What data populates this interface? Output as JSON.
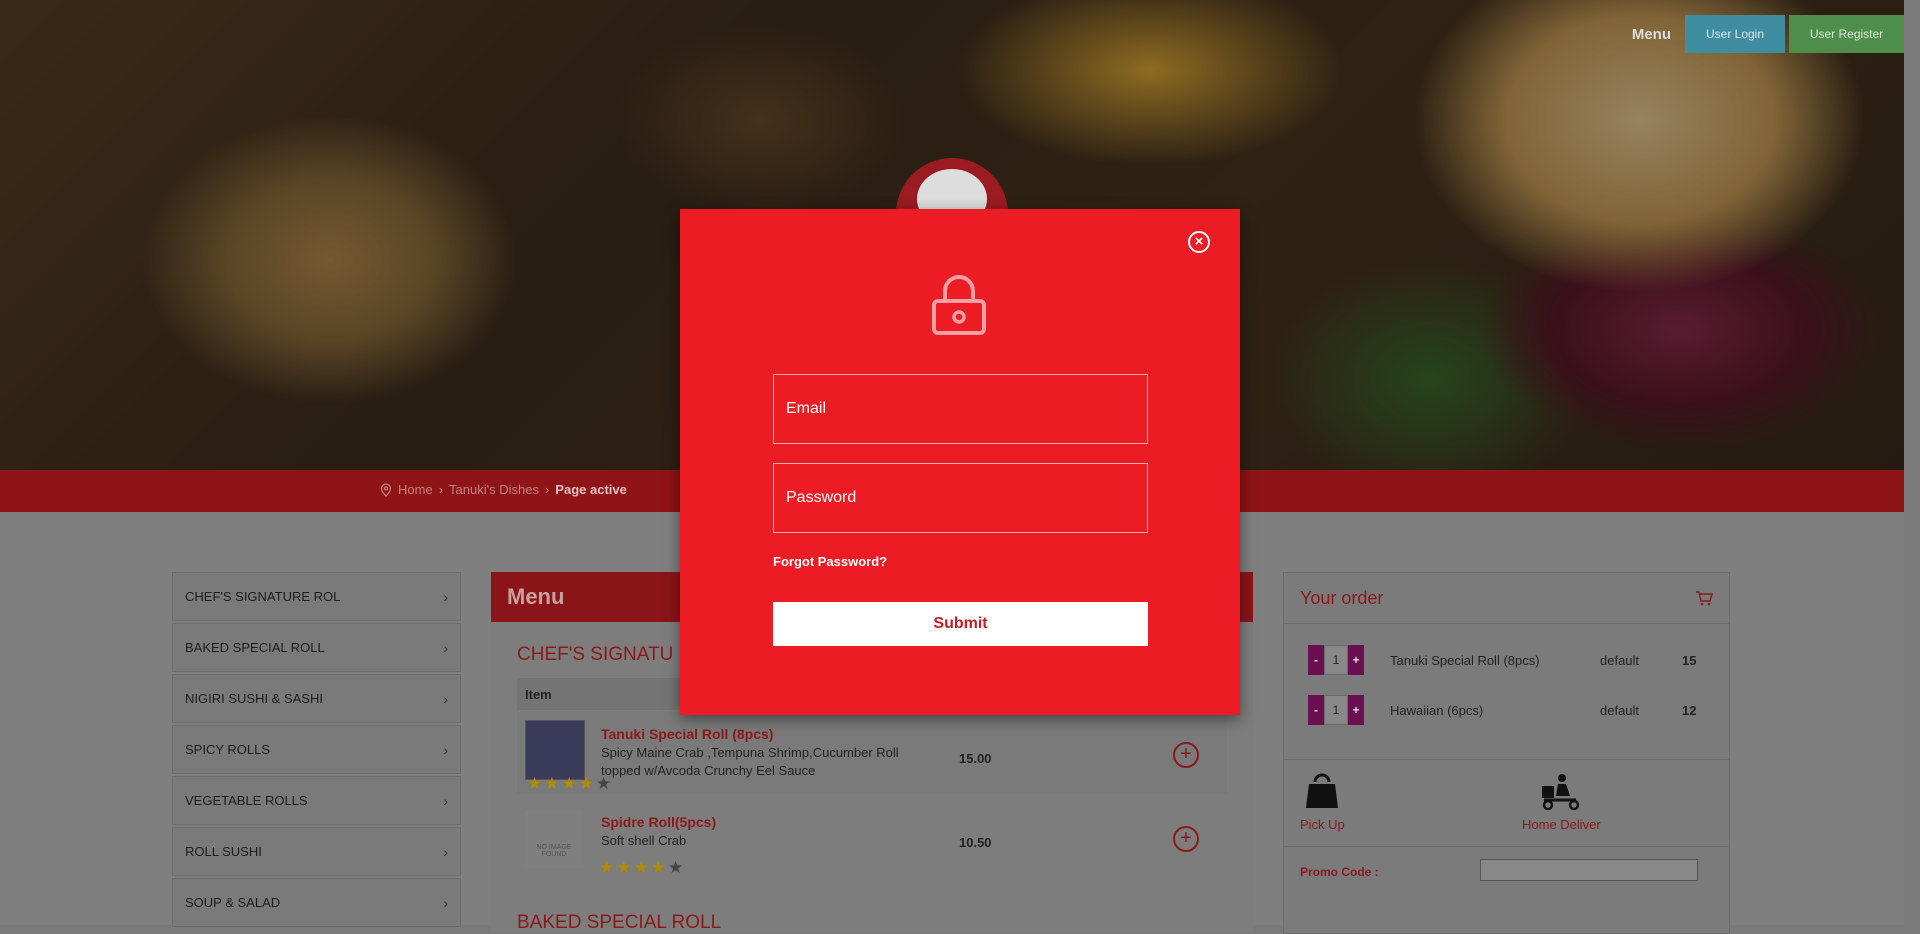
{
  "header": {
    "menu_label": "Menu",
    "login_label": "User Login",
    "register_label": "User Register"
  },
  "breadcrumb": {
    "home": "Home",
    "section": "Tanuki's Dishes",
    "current": "Page active",
    "separator": "›"
  },
  "sidebar": {
    "items": [
      {
        "label": "CHEF'S SIGNATURE ROL"
      },
      {
        "label": "BAKED SPECIAL ROLL"
      },
      {
        "label": "NIGIRI SUSHI & SASHI"
      },
      {
        "label": "SPICY ROLLS"
      },
      {
        "label": "VEGETABLE ROLLS"
      },
      {
        "label": "ROLL SUSHI"
      },
      {
        "label": "SOUP & SALAD"
      }
    ]
  },
  "menu": {
    "title": "Menu",
    "category": "CHEF'S SIGNATU",
    "column_item": "Item",
    "next_category": "BAKED SPECIAL ROLL",
    "dishes": [
      {
        "name": "Tanuki Special Roll (8pcs)",
        "desc": "Spicy Maine Crab ,Tempuna Shrimp,Cucumber Roll topped w/Avcoda Crunchy Eel Sauce",
        "price": "15.00",
        "rating": 4
      },
      {
        "name": "Spidre Roll(5pcs)",
        "desc": "Soft shell Crab",
        "price": "10.50",
        "rating": 4,
        "image_text": "NO IMAGE FOUND"
      }
    ]
  },
  "order": {
    "title": "Your order",
    "items": [
      {
        "qty": "1",
        "name": "Tanuki Special Roll (8pcs)",
        "variant": "default",
        "amount": "15"
      },
      {
        "qty": "1",
        "name": "Hawaiian (6pcs)",
        "variant": "default",
        "amount": "12"
      }
    ],
    "pickup_label": "Pick Up",
    "delivery_label": "Home Deliver",
    "promo_label": "Promo Code :"
  },
  "modal": {
    "email_placeholder": "Email",
    "password_placeholder": "Password",
    "forgot_label": "Forgot Password?",
    "submit_label": "Submit"
  },
  "colors": {
    "modal_bg": "#ec1c24",
    "brand_red": "#8a1418",
    "login_button": "#3f8ea0",
    "register_button": "#4f8d4a",
    "stepper": "#6a1050"
  },
  "icons": {
    "close": "close-circle-icon",
    "lock": "lock-icon",
    "cart": "cart-icon",
    "location": "location-pin-icon",
    "add": "add-circle-icon",
    "chevron": "chevron-right-icon",
    "pickup": "bag-icon",
    "delivery": "scooter-icon"
  }
}
